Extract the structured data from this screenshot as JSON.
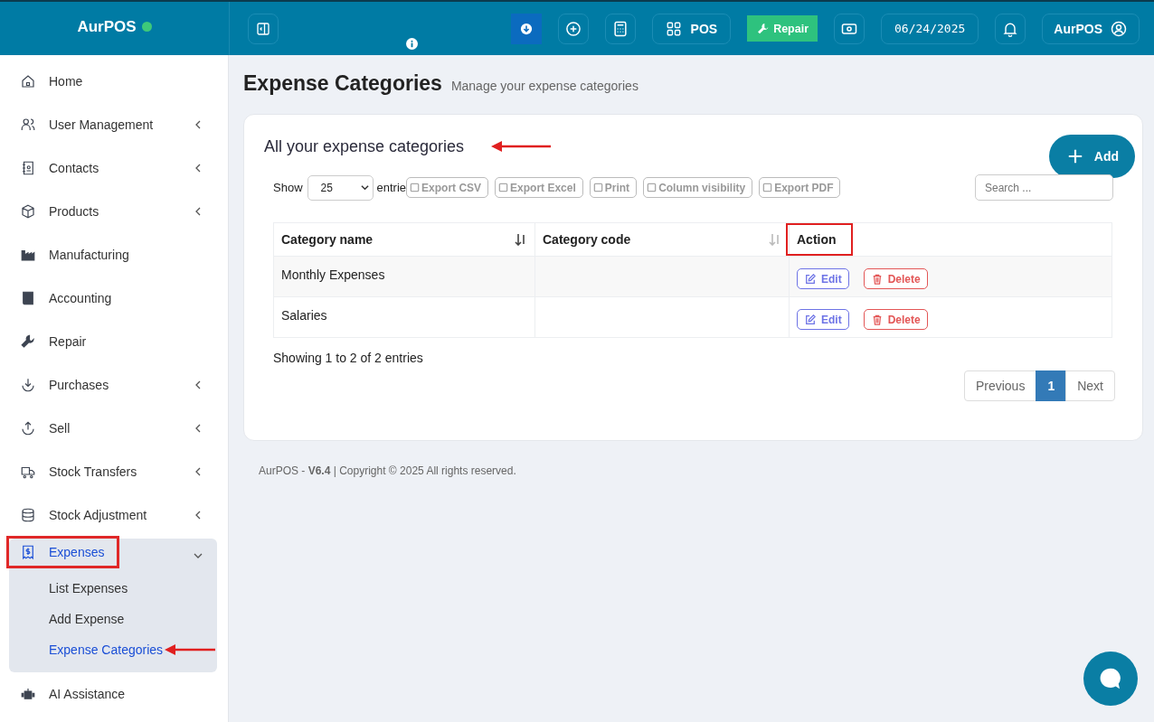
{
  "brand": {
    "name": "AurPOS",
    "online": true
  },
  "topbar": {
    "pos_label": "POS",
    "repair_label": "Repair",
    "date": "06/24/2025",
    "user": "AurPOS"
  },
  "sidebar": {
    "items": [
      {
        "label": "Home",
        "has_submenu": false
      },
      {
        "label": "User Management",
        "has_submenu": true
      },
      {
        "label": "Contacts",
        "has_submenu": true
      },
      {
        "label": "Products",
        "has_submenu": true
      },
      {
        "label": "Manufacturing",
        "has_submenu": false
      },
      {
        "label": "Accounting",
        "has_submenu": false
      },
      {
        "label": "Repair",
        "has_submenu": false
      },
      {
        "label": "Purchases",
        "has_submenu": true
      },
      {
        "label": "Sell",
        "has_submenu": true
      },
      {
        "label": "Stock Transfers",
        "has_submenu": true
      },
      {
        "label": "Stock Adjustment",
        "has_submenu": true
      },
      {
        "label": "Expenses",
        "has_submenu": true,
        "expanded": true,
        "selected": true,
        "outlined": true,
        "children": [
          {
            "label": "List Expenses",
            "selected": false,
            "pointed_at": false
          },
          {
            "label": "Add Expense",
            "selected": false,
            "pointed_at": false
          },
          {
            "label": "Expense Categories",
            "selected": true,
            "pointed_at": true
          }
        ]
      },
      {
        "label": "AI Assistance",
        "has_submenu": false
      }
    ]
  },
  "page": {
    "title": "Expense Categories",
    "subtitle": "Manage your expense categories"
  },
  "card": {
    "title": "All your expense categories",
    "title_pointed_at": true,
    "add_button": "Add",
    "show_label": "Show",
    "page_size": "25",
    "entries_label": "entrie",
    "export_buttons": [
      "Export CSV",
      "Export Excel",
      "Print",
      "Column visibility",
      "Export PDF"
    ],
    "search": {
      "placeholder": "Search ..."
    },
    "columns": [
      {
        "label": "Category name",
        "sortable": true,
        "sorted": true,
        "outlined": false
      },
      {
        "label": "Category code",
        "sortable": true,
        "sorted": false,
        "outlined": false
      },
      {
        "label": "Action",
        "sortable": false,
        "outlined": true
      }
    ],
    "rows": [
      {
        "name": "Monthly Expenses",
        "code": "",
        "edit": "Edit",
        "delete": "Delete"
      },
      {
        "name": "Salaries",
        "code": "",
        "edit": "Edit",
        "delete": "Delete"
      }
    ],
    "info": "Showing 1 to 2 of 2 entries",
    "pagination": [
      {
        "label": "Previous",
        "selected": false
      },
      {
        "label": "1",
        "selected": true
      },
      {
        "label": "Next",
        "selected": false
      }
    ]
  },
  "footer": {
    "text": "AurPOS - **V6.4** | Copyright © 2025 All rights reserved."
  }
}
